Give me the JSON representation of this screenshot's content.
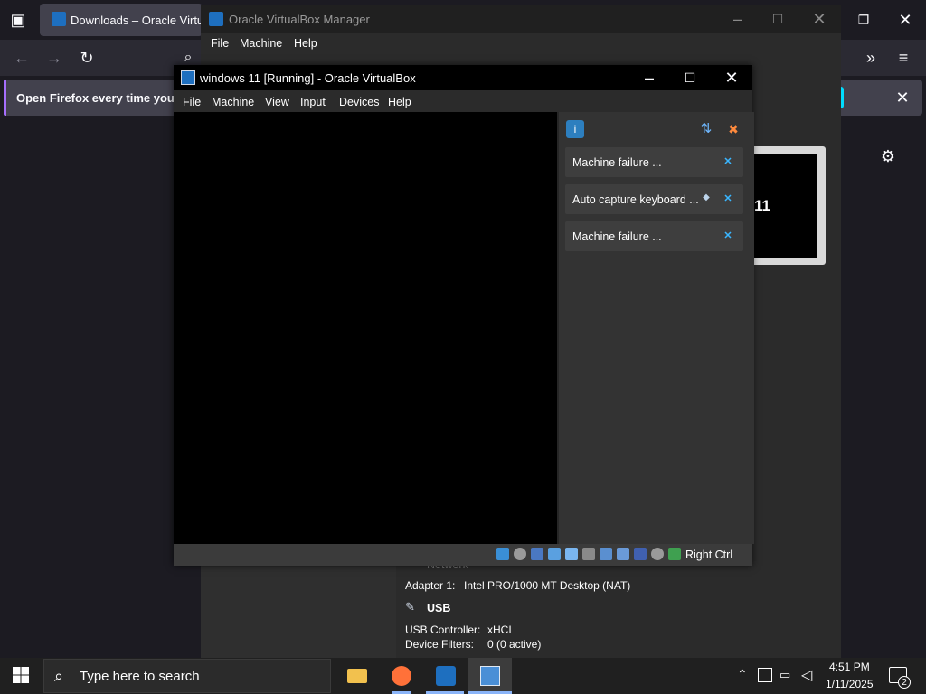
{
  "firefox": {
    "tab_title": "Downloads – Oracle VirtualBox",
    "notice_text": "Open Firefox every time you restart your computer?"
  },
  "manager": {
    "title": "Oracle VirtualBox Manager",
    "menu": [
      "File",
      "Machine",
      "Help"
    ],
    "preview_label": "11",
    "details": {
      "network_heading": "Network",
      "network_adapter_label": "Adapter 1:",
      "network_adapter_value": "Intel PRO/1000 MT Desktop (NAT)",
      "usb_heading": "USB",
      "usb_controller_label": "USB Controller:",
      "usb_controller_value": "xHCI",
      "device_filters_label": "Device Filters:",
      "device_filters_value": "0 (0 active)"
    }
  },
  "vm_window": {
    "title": "windows 11 [Running] - Oracle VirtualBox",
    "menu": [
      "File",
      "Machine",
      "View",
      "Input",
      "Devices",
      "Help"
    ],
    "notifications": [
      "Machine failure ...",
      "Auto capture keyboard ...",
      "Machine failure ..."
    ],
    "host_key": "Right Ctrl"
  },
  "taskbar": {
    "search_placeholder": "Type here to search",
    "time": "4:51 PM",
    "date": "1/11/2025",
    "notification_count": "2"
  },
  "colors": {
    "firefox_bg": "#1c1b22",
    "vbox_bg": "#2b2b2b",
    "accent_blue": "#3ab6ff",
    "taskbar": "#202020"
  }
}
